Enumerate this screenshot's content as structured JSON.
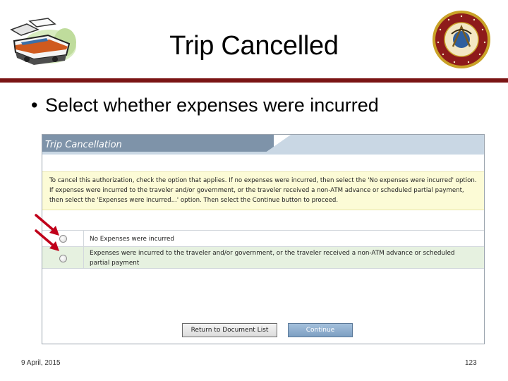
{
  "slide": {
    "title": "Trip Cancelled",
    "bullet": "Select whether expenses were incurred",
    "footer_date": "9 April, 2015",
    "page_number": "123",
    "accent_color": "#7a1414"
  },
  "seal": {
    "text": "DEPARTMENT OF THE NAVY · UNITED STATES MARINE CORPS",
    "icon": "usmc-seal"
  },
  "logo": {
    "icon": "train-clipart"
  },
  "screen": {
    "title": "Trip Cancellation",
    "notice": "To cancel this authorization, check the option that applies. If no expenses were incurred, then select the 'No expenses were incurred' option. If expenses were incurred to the traveler and/or government, or the traveler received a non-ATM advance or scheduled partial payment, then select the 'Expenses were incurred...' option. Then select the Continue button to proceed.",
    "options": [
      {
        "label": "No Expenses were incurred",
        "selected": false
      },
      {
        "label": "Expenses were incurred to the traveler and/or government, or the traveler received a non-ATM advance or scheduled partial payment",
        "selected": false
      }
    ],
    "buttons": {
      "return": "Return to Document List",
      "continue": "Continue"
    }
  },
  "annotations": {
    "arrow_color": "#c0001a",
    "arrow_count": 2
  }
}
